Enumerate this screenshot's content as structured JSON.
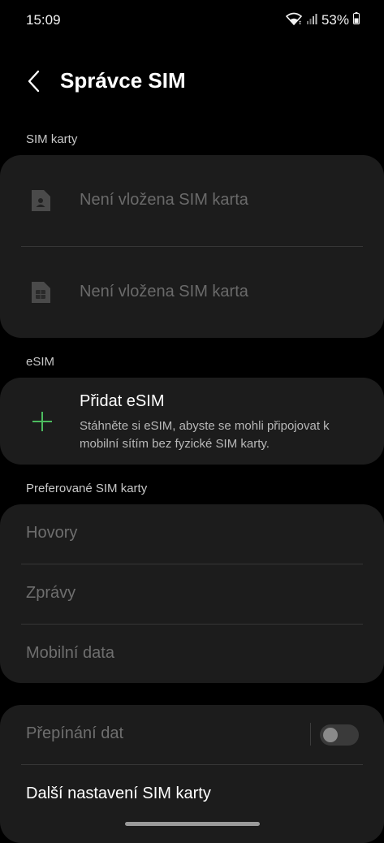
{
  "status_bar": {
    "time": "15:09",
    "battery": "53%",
    "icons": [
      "wifi-icon",
      "signal-icon",
      "battery-icon"
    ]
  },
  "header": {
    "title": "Správce SIM",
    "back_icon": "chevron-left-icon"
  },
  "sim_cards": {
    "section_title": "SIM karty",
    "items": [
      {
        "label": "Není vložena SIM karta",
        "icon": "sim-1-icon"
      },
      {
        "label": "Není vložena SIM karta",
        "icon": "sim-2-icon"
      }
    ]
  },
  "esim": {
    "section_title": "eSIM",
    "add_title": "Přidat eSIM",
    "add_description": "Stáhněte si eSIM, abyste se mohli připojovat k mobilní sítím bez fyzické SIM karty.",
    "icon": "plus-icon",
    "accent_color": "#4cbb5f"
  },
  "preferred": {
    "section_title": "Preferované SIM karty",
    "items": [
      {
        "label": "Hovory"
      },
      {
        "label": "Zprávy"
      },
      {
        "label": "Mobilní data"
      }
    ]
  },
  "more": {
    "data_switching_label": "Přepínání dat",
    "data_switching_enabled": false,
    "more_settings_label": "Další nastavení SIM karty"
  }
}
